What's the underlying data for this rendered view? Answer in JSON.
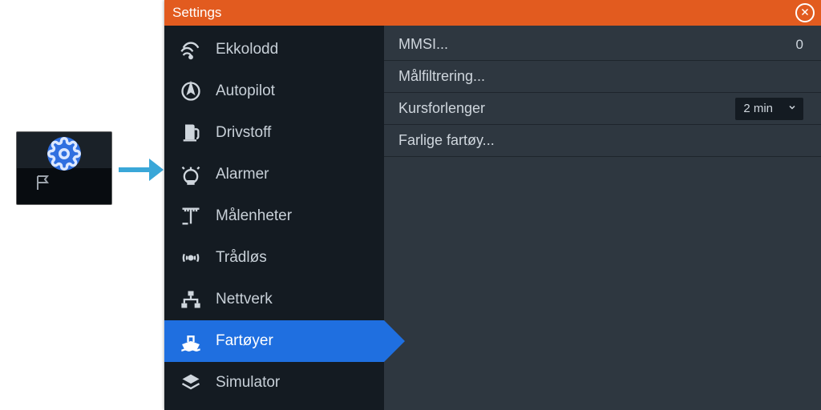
{
  "window": {
    "title": "Settings"
  },
  "sidebar": {
    "items": [
      {
        "id": "ekkolodd",
        "label": "Ekkolodd"
      },
      {
        "id": "autopilot",
        "label": "Autopilot"
      },
      {
        "id": "drivstoff",
        "label": "Drivstoff"
      },
      {
        "id": "alarmer",
        "label": "Alarmer"
      },
      {
        "id": "malenheter",
        "label": "Målenheter"
      },
      {
        "id": "tradlos",
        "label": "Trådløs"
      },
      {
        "id": "nettverk",
        "label": "Nettverk"
      },
      {
        "id": "fartoyer",
        "label": "Fartøyer",
        "selected": true
      },
      {
        "id": "simulator",
        "label": "Simulator"
      }
    ]
  },
  "content": {
    "rows": [
      {
        "id": "mmsi",
        "label": "MMSI...",
        "value": "0",
        "kind": "nav"
      },
      {
        "id": "malfiltrering",
        "label": "Målfiltrering...",
        "kind": "nav"
      },
      {
        "id": "kursforlenger",
        "label": "Kursforlenger",
        "kind": "select",
        "selected": "2 min"
      },
      {
        "id": "farlige",
        "label": "Farlige fartøy...",
        "kind": "nav"
      }
    ]
  }
}
